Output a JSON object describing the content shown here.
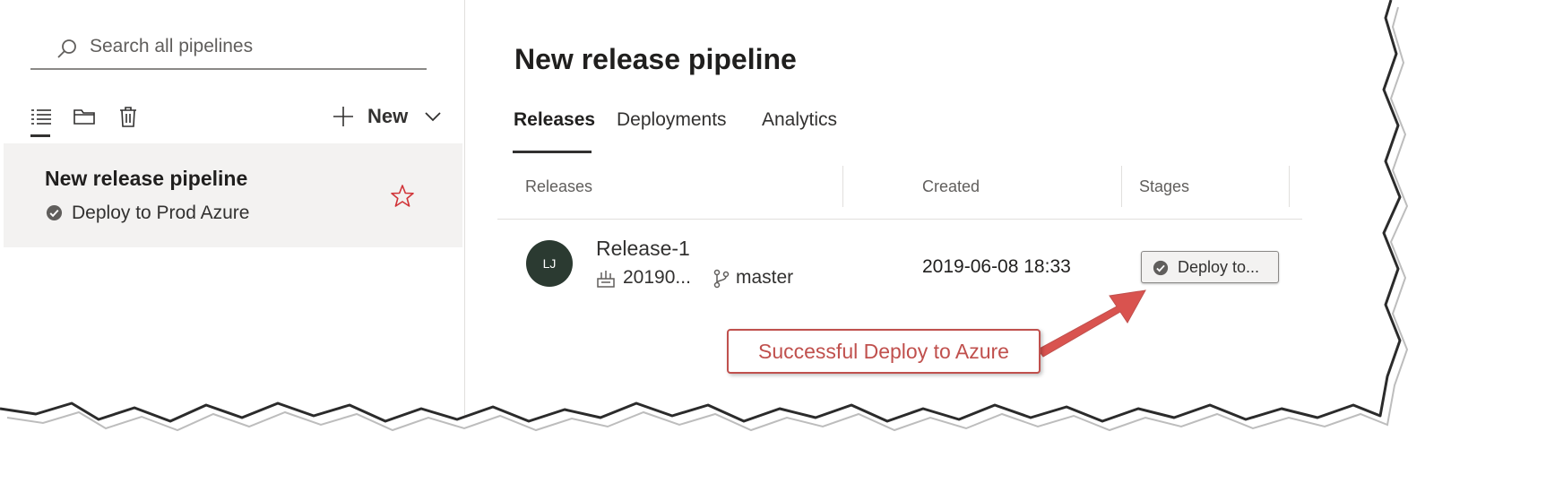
{
  "sidebar": {
    "search": {
      "placeholder": "Search all pipelines",
      "icon": "search-icon"
    },
    "toolbar": {
      "icons": [
        "list-icon",
        "folder-icon",
        "trash-icon"
      ],
      "new_label": "New"
    },
    "pipeline": {
      "name": "New release pipeline",
      "subtitle": "Deploy to Prod Azure",
      "status_icon": "check-circle-icon",
      "favorite_icon": "star-outline-icon"
    }
  },
  "main": {
    "title": "New release pipeline",
    "tabs": [
      {
        "label": "Releases",
        "active": true
      },
      {
        "label": "Deployments",
        "active": false
      },
      {
        "label": "Analytics",
        "active": false
      }
    ],
    "columns": [
      "Releases",
      "Created",
      "Stages"
    ],
    "releases": [
      {
        "avatar_initials": "LJ",
        "name": "Release-1",
        "build": "20190...",
        "branch": "master",
        "created": "2019-06-08 18:33",
        "stage": "Deploy to..."
      }
    ]
  },
  "annotation": {
    "text": "Successful Deploy to Azure"
  },
  "colors": {
    "annotation": "#c0504d",
    "avatar": "#2b3a31",
    "selected_row": "#f3f2f1",
    "star": "#d13438"
  }
}
